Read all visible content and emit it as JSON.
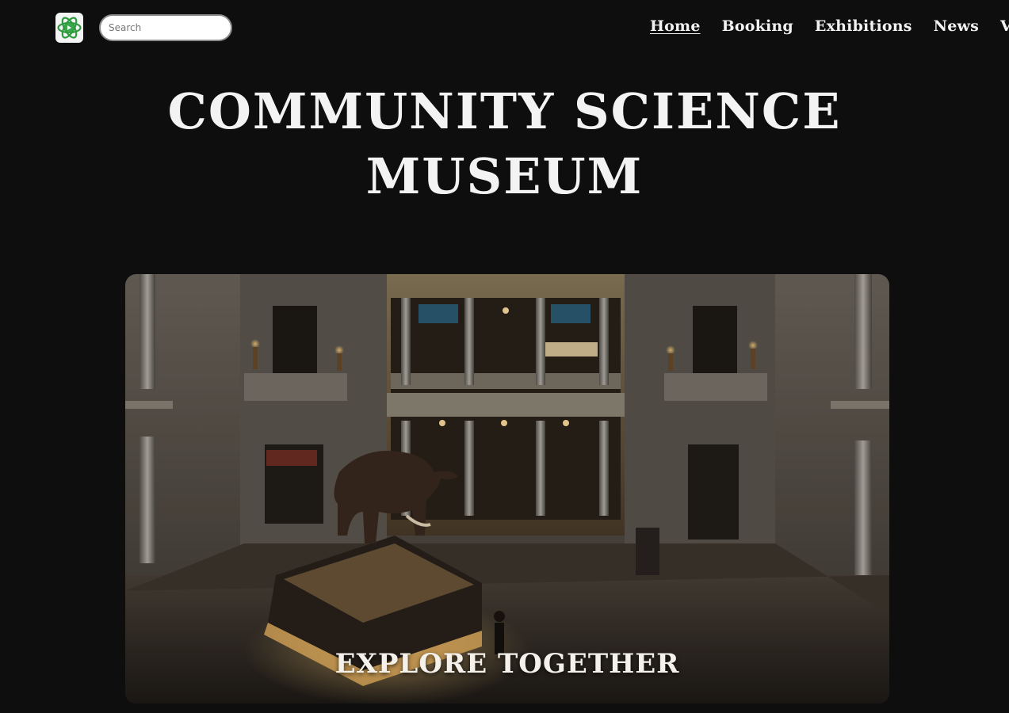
{
  "header": {
    "logo_icon": "atom-leaf-logo-icon",
    "search": {
      "placeholder": "Search",
      "value": ""
    },
    "nav": [
      {
        "label": "Home",
        "active": true
      },
      {
        "label": "Booking",
        "active": false
      },
      {
        "label": "Exhibitions",
        "active": false
      },
      {
        "label": "News",
        "active": false
      },
      {
        "label": "Visit",
        "active": false
      }
    ]
  },
  "hero": {
    "title_line1": "COMMUNITY SCIENCE",
    "title_line2": "MUSEUM",
    "caption": "EXPLORE TOGETHER",
    "image_subject": "museum-rotunda-elephant-photo"
  },
  "colors": {
    "background": "#0e0e0e",
    "text": "#f3f3f3",
    "logo_green": "#2e9a3e"
  }
}
